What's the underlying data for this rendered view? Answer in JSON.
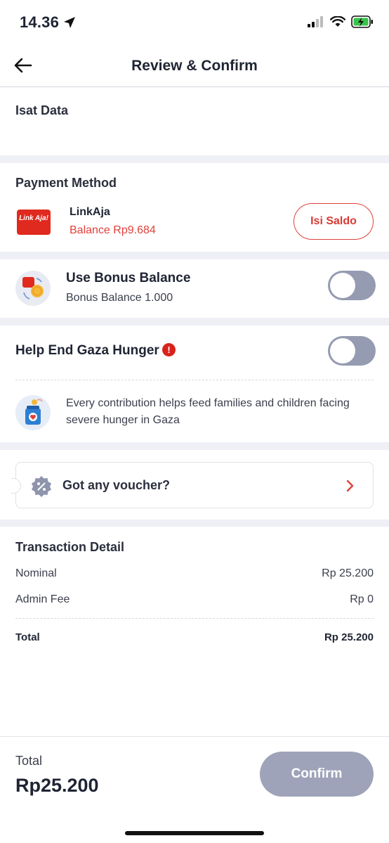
{
  "status": {
    "time": "14.36"
  },
  "header": {
    "title": "Review & Confirm"
  },
  "product": {
    "name": "Isat Data"
  },
  "payment": {
    "title": "Payment Method",
    "logo_text": "Link Aja!",
    "name": "LinkAja",
    "balance": "Balance Rp9.684",
    "topup_label": "Isi Saldo"
  },
  "bonus": {
    "title": "Use Bonus Balance",
    "subtitle": "Bonus Balance 1.000",
    "enabled": false
  },
  "donation": {
    "title": "Help End Gaza Hunger",
    "alert": "!",
    "description": "Every contribution helps feed families and children facing severe hunger in Gaza",
    "enabled": false
  },
  "voucher": {
    "label": "Got any voucher?"
  },
  "transaction": {
    "title": "Transaction Detail",
    "rows": [
      {
        "label": "Nominal",
        "value": "Rp 25.200"
      },
      {
        "label": "Admin Fee",
        "value": "Rp 0"
      }
    ],
    "total_label": "Total",
    "total_value": "Rp 25.200"
  },
  "footer": {
    "total_label": "Total",
    "total_value": "Rp25.200",
    "confirm_label": "Confirm"
  },
  "colors": {
    "accent_red": "#e0413a",
    "toggle_off": "#959bb0",
    "confirm_disabled": "#9ea3b9",
    "separator": "#efeff6"
  }
}
